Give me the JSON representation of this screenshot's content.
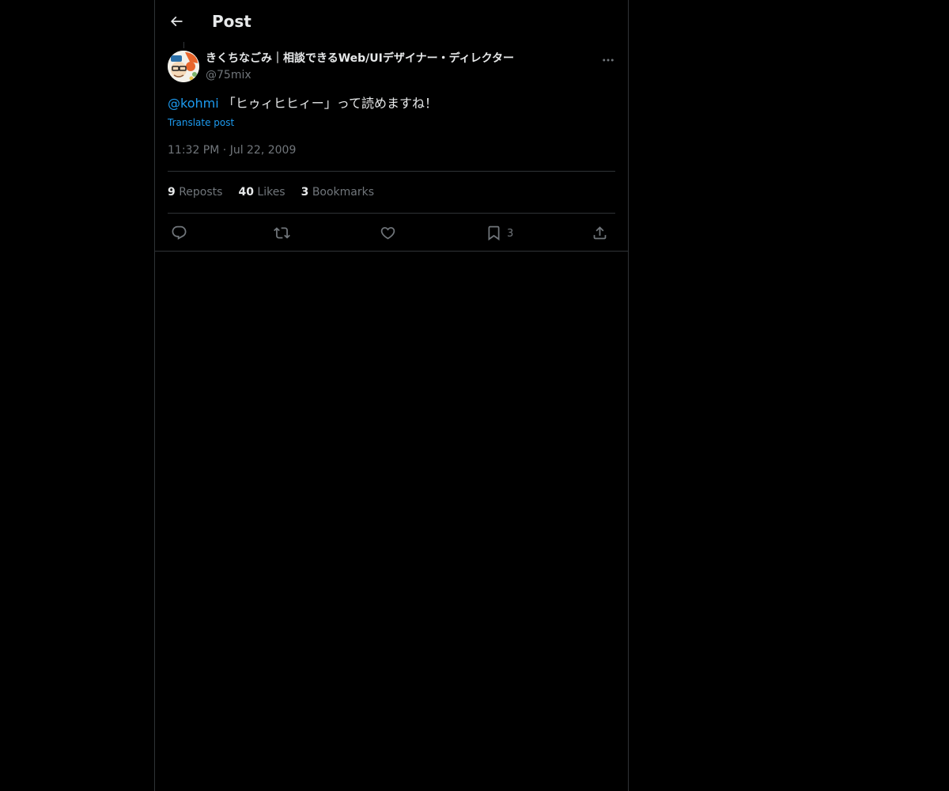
{
  "header": {
    "title": "Post",
    "back_icon": "arrow-left-icon"
  },
  "post": {
    "author": {
      "name": "きくちなごみ｜相談できるWeb/UIデザイナー・ディレクター",
      "handle": "@75mix"
    },
    "mention": "@kohmi",
    "text": " 「ヒゥィヒヒィー」って読めますね！",
    "translate_label": "Translate post",
    "time": "11:32 PM",
    "separator": "·",
    "date": "Jul 22, 2009",
    "stats": {
      "reposts_count": "9",
      "reposts_label": "Reposts",
      "likes_count": "40",
      "likes_label": "Likes",
      "bookmarks_count": "3",
      "bookmarks_label": "Bookmarks"
    },
    "actions": {
      "reply_icon": "reply-icon",
      "repost_icon": "repost-icon",
      "like_icon": "heart-icon",
      "bookmark_icon": "bookmark-icon",
      "bookmark_count": "3",
      "share_icon": "share-icon"
    }
  },
  "colors": {
    "background": "#000000",
    "text": "#e7e9ea",
    "secondary": "#71767b",
    "accent": "#1d9bf0",
    "border": "#2f3336"
  }
}
